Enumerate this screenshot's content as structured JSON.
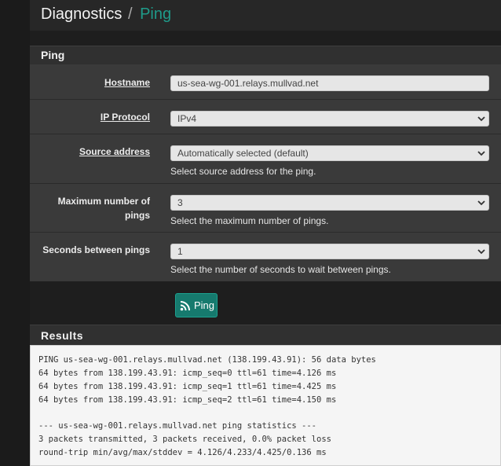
{
  "breadcrumb": {
    "root": "Diagnostics",
    "separator": "/",
    "current": "Ping"
  },
  "ping_panel": {
    "title": "Ping",
    "fields": {
      "hostname": {
        "label": "Hostname",
        "value": "us-sea-wg-001.relays.mullvad.net"
      },
      "ip_protocol": {
        "label": "IP Protocol",
        "value": "IPv4"
      },
      "source_address": {
        "label": "Source address",
        "value": "Automatically selected (default)",
        "help": "Select source address for the ping."
      },
      "max_pings": {
        "label_line1": "Maximum number of",
        "label_line2": "pings",
        "value": "3",
        "help": "Select the maximum number of pings."
      },
      "seconds_between": {
        "label": "Seconds between pings",
        "value": "1",
        "help": "Select the number of seconds to wait between pings."
      }
    },
    "button_label": "Ping"
  },
  "results": {
    "title": "Results",
    "lines": [
      "PING us-sea-wg-001.relays.mullvad.net (138.199.43.91): 56 data bytes",
      "64 bytes from 138.199.43.91: icmp_seq=0 ttl=61 time=4.126 ms",
      "64 bytes from 138.199.43.91: icmp_seq=1 ttl=61 time=4.425 ms",
      "64 bytes from 138.199.43.91: icmp_seq=2 ttl=61 time=4.150 ms",
      "",
      "--- us-sea-wg-001.relays.mullvad.net ping statistics ---",
      "3 packets transmitted, 3 packets received, 0.0% packet loss",
      "round-trip min/avg/max/stddev = 4.126/4.233/4.425/0.136 ms"
    ]
  },
  "icons": {
    "dropdown": "chevron-down-icon",
    "ping_button": "rss-icon"
  },
  "colors": {
    "accent": "#1f9b8a",
    "button": "#167a6e",
    "page_background": "#1e1e1e",
    "form_background": "#3a3a3a"
  }
}
